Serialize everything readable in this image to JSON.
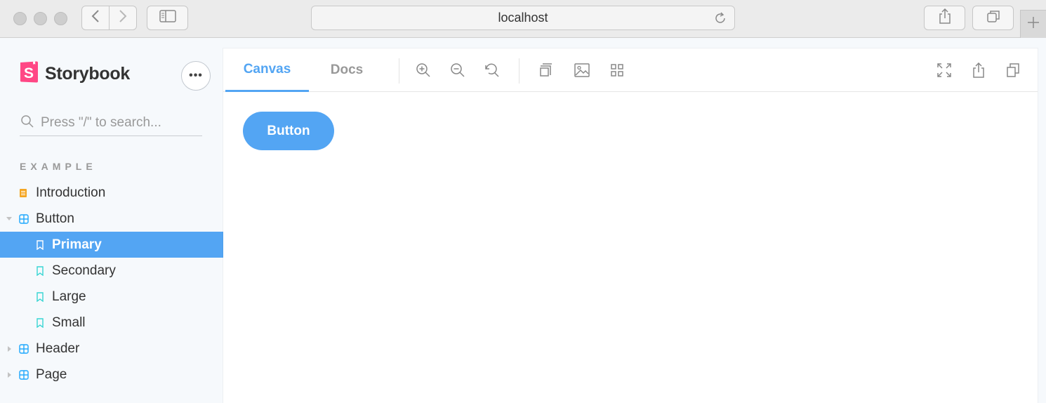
{
  "browser": {
    "address": "localhost",
    "icons": [
      "back-icon",
      "forward-icon",
      "sidebar-icon",
      "reload-icon",
      "share-icon",
      "tabs-icon",
      "plus-icon"
    ]
  },
  "sidebar": {
    "brand": "Storybook",
    "brand_color": "#ff4785",
    "menu_label": "•••",
    "search_placeholder": "Press \"/\" to search...",
    "section": "EXAMPLE",
    "items": [
      {
        "label": "Introduction",
        "icon": "document-icon",
        "icon_color": "#f4a623",
        "level": 1,
        "expanded": null
      },
      {
        "label": "Button",
        "icon": "component-icon",
        "icon_color": "#1ea7fd",
        "level": 1,
        "expanded": true
      },
      {
        "label": "Primary",
        "icon": "bookmark-icon",
        "icon_color": "#37d5d3",
        "level": 2,
        "selected": true
      },
      {
        "label": "Secondary",
        "icon": "bookmark-icon",
        "icon_color": "#37d5d3",
        "level": 2
      },
      {
        "label": "Large",
        "icon": "bookmark-icon",
        "icon_color": "#37d5d3",
        "level": 2
      },
      {
        "label": "Small",
        "icon": "bookmark-icon",
        "icon_color": "#37d5d3",
        "level": 2
      },
      {
        "label": "Header",
        "icon": "component-icon",
        "icon_color": "#1ea7fd",
        "level": 1,
        "expanded": false
      },
      {
        "label": "Page",
        "icon": "component-icon",
        "icon_color": "#1ea7fd",
        "level": 1,
        "expanded": false
      }
    ]
  },
  "toolbar": {
    "tabs": [
      {
        "label": "Canvas",
        "active": true
      },
      {
        "label": "Docs",
        "active": false
      }
    ],
    "tools": [
      "zoom-in-icon",
      "zoom-out-icon",
      "zoom-reset-icon",
      "outline-icon",
      "background-icon",
      "grid-icon"
    ],
    "right_tools": [
      "fullscreen-icon",
      "share-icon",
      "copy-icon"
    ]
  },
  "canvas": {
    "button_label": "Button"
  },
  "colors": {
    "accent": "#53a5f3",
    "sidebar_bg": "#f6f9fc",
    "selected_bg": "#53a5f3"
  }
}
